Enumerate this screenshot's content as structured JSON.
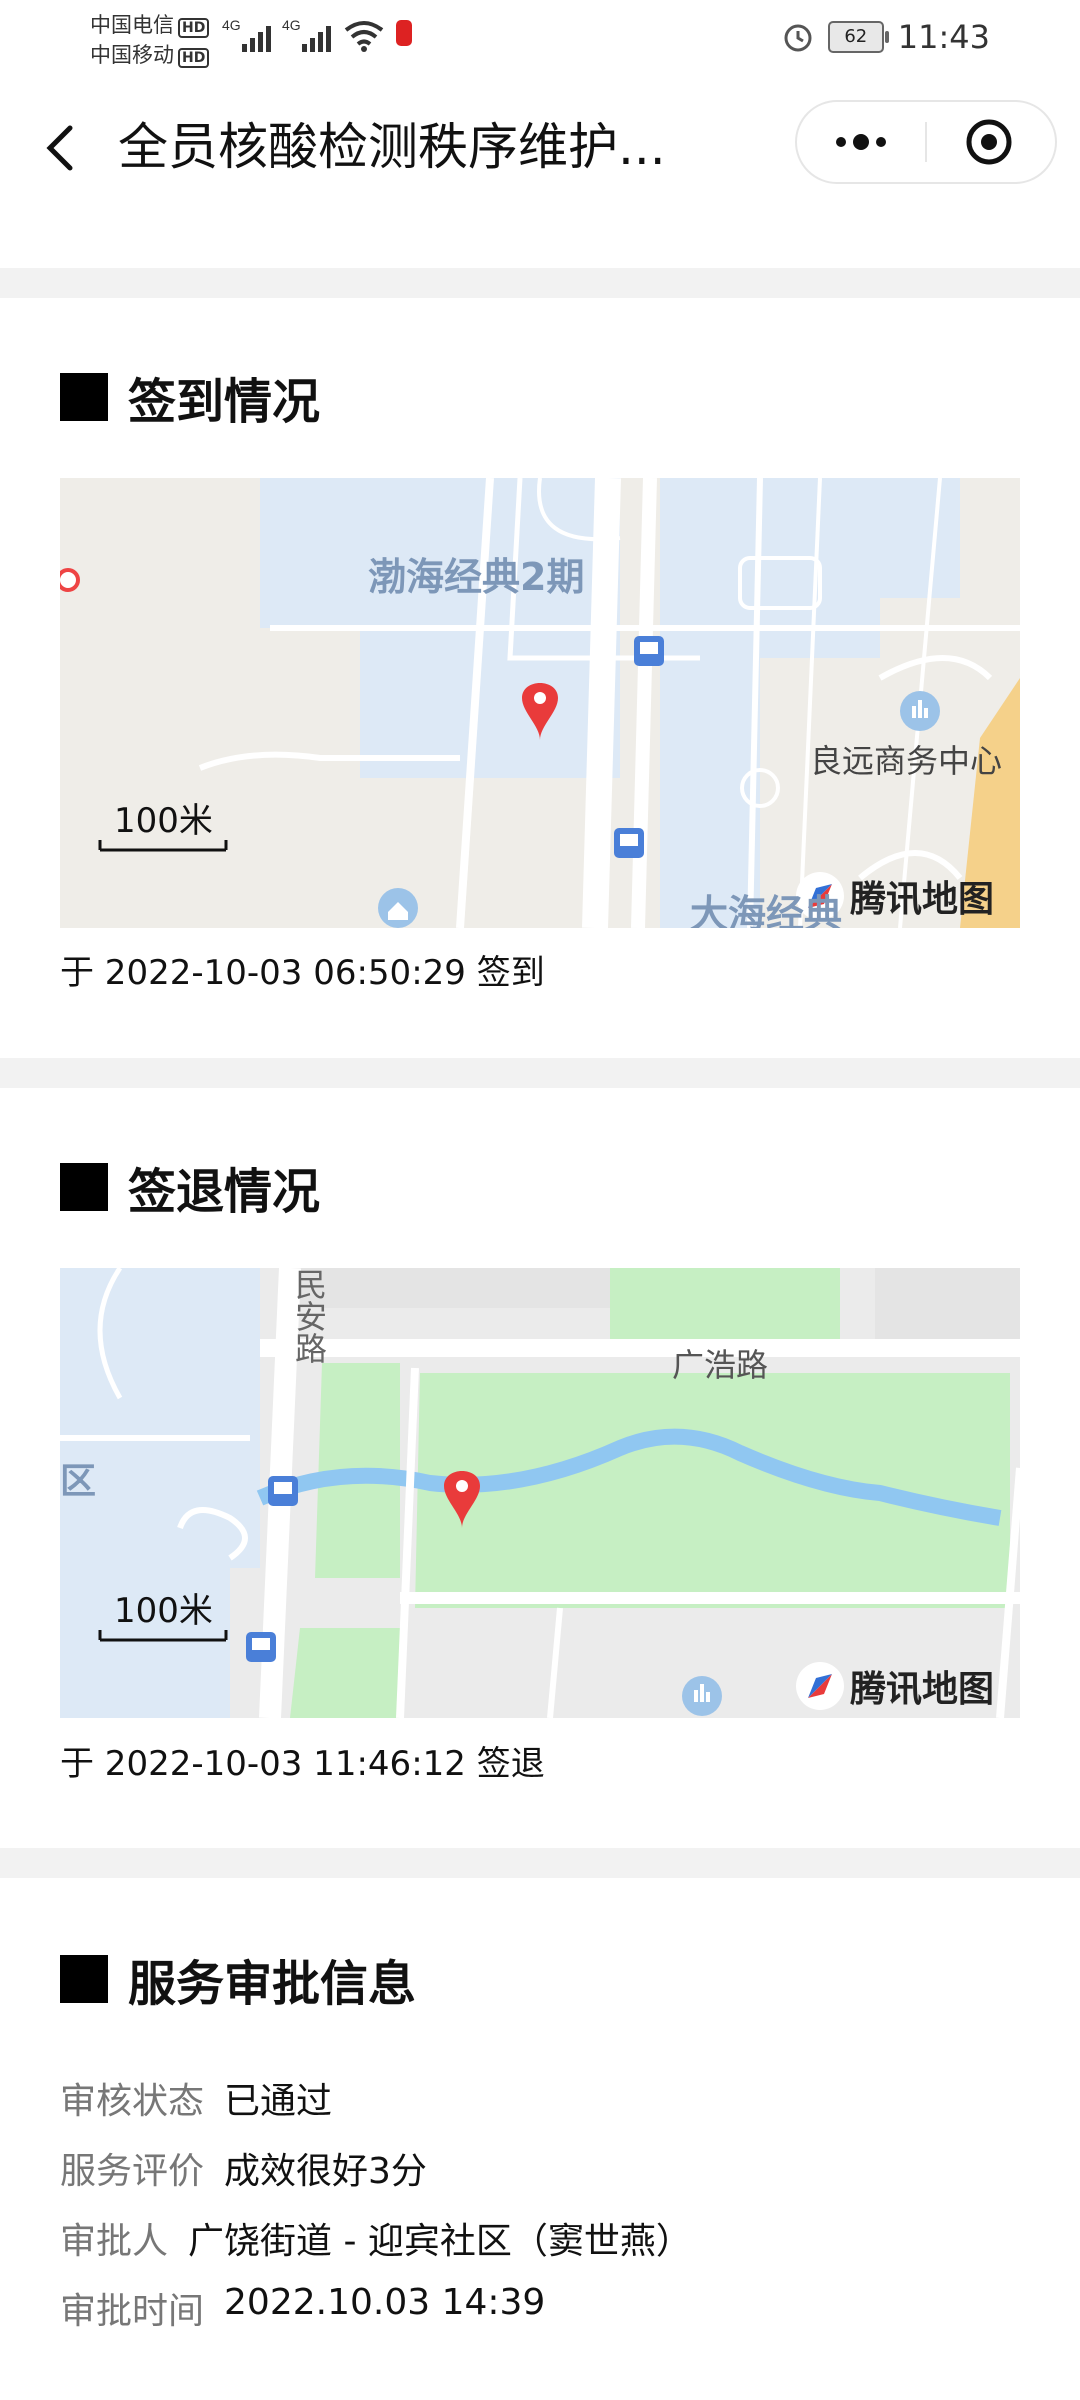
{
  "status_bar": {
    "carrier1": "中国电信",
    "carrier2": "中国移动",
    "hd": "HD",
    "net": "4G",
    "battery": "62",
    "time": "11:43"
  },
  "nav": {
    "title": "全员核酸检测秩序维护..."
  },
  "checkin": {
    "title": "签到情况",
    "caption": "于 2022-10-03 06:50:29 签到",
    "map": {
      "label_building": "渤海经典2期",
      "label_business": "良远商务中心",
      "label_bottom": "大海经典",
      "scale": "100米",
      "brand": "腾讯地图"
    }
  },
  "checkout": {
    "title": "签退情况",
    "caption": "于 2022-10-03 11:46:12 签退",
    "map": {
      "label_road_top": "民安路",
      "label_road": "广浩路",
      "label_district": "区",
      "scale": "100米",
      "brand": "腾讯地图"
    }
  },
  "approval": {
    "title": "服务审批信息",
    "rows": [
      {
        "label": "审核状态",
        "value": "已通过"
      },
      {
        "label": "服务评价",
        "value": "成效很好3分"
      },
      {
        "label": "审批人",
        "value": "广饶街道 - 迎宾社区（窦世燕）"
      },
      {
        "label": "审批时间",
        "value": "2022.10.03 14:39"
      }
    ]
  },
  "colors": {
    "map_water": "#dde9f6",
    "map_green": "#c6efc3",
    "map_river": "#90c7f1",
    "pin_red": "#e93b3b",
    "gap_gray": "#f2f2f2"
  }
}
